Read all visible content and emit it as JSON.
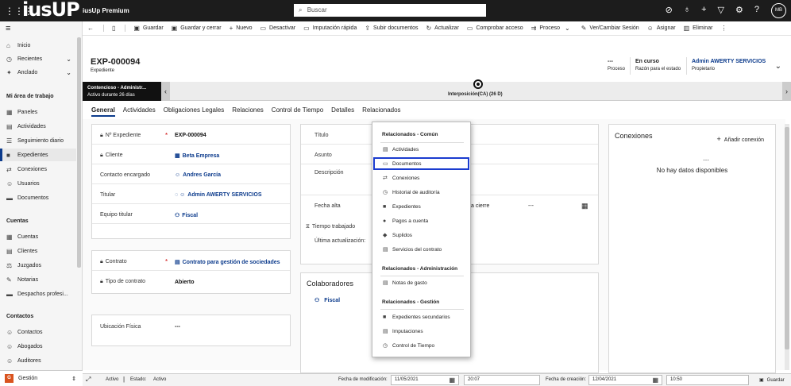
{
  "app": {
    "logo": "iusUP",
    "name": "iusUp Premium",
    "avatar": "MB"
  },
  "search": {
    "placeholder": "Buscar"
  },
  "topicons": [
    "lightbulb-icon",
    "location-icon",
    "plus-icon",
    "filter-icon",
    "gear-icon",
    "help-icon"
  ],
  "sidebar": {
    "top": [
      {
        "label": "Inicio",
        "icon": "⌂"
      },
      {
        "label": "Recientes",
        "icon": "◷",
        "chevron": "⌄"
      },
      {
        "label": "Anclado",
        "icon": "✦",
        "chevron": "⌄"
      }
    ],
    "section1": "Mi área de trabajo",
    "work": [
      {
        "label": "Paneles",
        "icon": "▦"
      },
      {
        "label": "Actividades",
        "icon": "▤"
      },
      {
        "label": "Seguimiento diario",
        "icon": "☰"
      },
      {
        "label": "Expedientes",
        "icon": "■"
      },
      {
        "label": "Conexiones",
        "icon": "⇄"
      },
      {
        "label": "Usuarios",
        "icon": "☺"
      },
      {
        "label": "Documentos",
        "icon": "▬"
      }
    ],
    "section2": "Cuentas",
    "accounts": [
      {
        "label": "Cuentas",
        "icon": "▦"
      },
      {
        "label": "Clientes",
        "icon": "▤"
      },
      {
        "label": "Juzgados",
        "icon": "⚖"
      },
      {
        "label": "Notarias",
        "icon": "✎"
      },
      {
        "label": "Despachos profesi...",
        "icon": "▬"
      }
    ],
    "section3": "Contactos",
    "contacts": [
      {
        "label": "Contactos",
        "icon": "☺"
      },
      {
        "label": "Abogados",
        "icon": "☺"
      },
      {
        "label": "Auditores",
        "icon": "☺"
      }
    ],
    "area": {
      "badge": "G",
      "label": "Gestión",
      "chevron": "⇕"
    }
  },
  "commands": [
    {
      "label": "Guardar",
      "icon": "💾"
    },
    {
      "label": "Guardar y cerrar",
      "icon": "▣"
    },
    {
      "label": "Nuevo",
      "icon": "+"
    },
    {
      "label": "Desactivar",
      "icon": "▭"
    },
    {
      "label": "Imputación rápida",
      "icon": "▭"
    },
    {
      "label": "Subir documentos",
      "icon": "⇪"
    },
    {
      "label": "Actualizar",
      "icon": "↻"
    },
    {
      "label": "Comprobar acceso",
      "icon": "▭"
    },
    {
      "label": "Proceso",
      "icon": "⇉",
      "chevron": "⌄"
    },
    {
      "label": "Ver/Cambiar Sesión",
      "icon": "✎"
    },
    {
      "label": "Asignar",
      "icon": "☺"
    },
    {
      "label": "Eliminar",
      "icon": "🗑"
    }
  ],
  "record": {
    "title": "EXP-000094",
    "type": "Expediente",
    "fields": [
      {
        "value": "---",
        "label": "Proceso"
      },
      {
        "value": "En curso",
        "label": "Razón para el estado"
      },
      {
        "value": "Admin AWERTY SERVICIOS",
        "label": "Propietario"
      }
    ]
  },
  "bpf": {
    "stage_name": "Contencioso - Administr...",
    "stage_duration": "Activo durante 26 días",
    "current": "Interposición(CA)  (26 D)"
  },
  "tabs": [
    "General",
    "Actividades",
    "Obligaciones Legales",
    "Relaciones",
    "Control de Tiempo",
    "Detalles",
    "Relacionados"
  ],
  "general": {
    "card1": [
      {
        "label": "Nº Expediente",
        "value": "EXP-000094",
        "locked": true,
        "required": true,
        "link": false
      },
      {
        "label": "Cliente",
        "value": "Beta Empresa",
        "locked": true,
        "required": false,
        "link": true,
        "vicon": "▦"
      },
      {
        "label": "Contacto encargado",
        "value": "Andres García",
        "locked": false,
        "required": false,
        "link": true,
        "vicon": "☺"
      },
      {
        "label": "Titular",
        "value": "Admin AWERTY SERVICIOS",
        "locked": false,
        "required": false,
        "link": true,
        "vicon": "◌ ☺"
      },
      {
        "label": "Equipo titular",
        "value": "Fiscal",
        "locked": false,
        "required": false,
        "link": true,
        "vicon": "⚇"
      }
    ],
    "card2": [
      {
        "label": "Contrato",
        "value": "Contrato para gestión de sociedades",
        "locked": true,
        "required": true,
        "link": true,
        "vicon": "▤"
      },
      {
        "label": "Tipo de contrato",
        "value": "Abierto",
        "locked": true,
        "required": false,
        "link": false
      }
    ],
    "card3": [
      {
        "label": "Ubicación Física",
        "value": "---",
        "locked": false,
        "required": false,
        "link": false
      }
    ]
  },
  "middle": {
    "titulo": "Título",
    "asunto": "Asunto",
    "descripcion": "Descripción",
    "fecha_alta": "Fecha alta",
    "fecha_cierre": "a cierre",
    "fecha_cierre_value": "---",
    "tiempo": "Tiempo trabajado",
    "ultima": "Última actualización:",
    "colaboradores": "Colaboradores",
    "colab_item": "Fiscal"
  },
  "connections": {
    "title": "Conexiones",
    "add": "Añadir conexión",
    "empty": "No hay datos disponibles"
  },
  "dropdown": {
    "head1": "Relacionados - Común",
    "common": [
      {
        "label": "Actividades",
        "icon": "▤"
      },
      {
        "label": "Documentos",
        "icon": "▭",
        "focus": true
      },
      {
        "label": "Conexiones",
        "icon": "⇄"
      },
      {
        "label": "Historial de auditoría",
        "icon": "◷"
      },
      {
        "label": "Expedientes",
        "icon": "■"
      },
      {
        "label": "Pagos a cuenta",
        "icon": "●"
      },
      {
        "label": "Suplidos",
        "icon": "◆"
      },
      {
        "label": "Servicios del contrato",
        "icon": "▤"
      }
    ],
    "head2": "Relacionados - Administración",
    "admin": [
      {
        "label": "Notas de gasto",
        "icon": "▤"
      }
    ],
    "head3": "Relacionados - Gestión",
    "gestion": [
      {
        "label": "Expedientes secundarios",
        "icon": "■"
      },
      {
        "label": "Imputaciones",
        "icon": "▤"
      },
      {
        "label": "Control de Tiempo",
        "icon": "◷"
      }
    ]
  },
  "footer": {
    "status": "Activo",
    "estado_label": "Estado:",
    "estado_value": "Activo",
    "mod_label": "Fecha de modificación:",
    "mod_date": "11/05/2021",
    "mod_time": "20:07",
    "cre_label": "Fecha de creación:",
    "cre_date": "12/04/2021",
    "cre_time": "10:50",
    "save": "Guardar"
  }
}
